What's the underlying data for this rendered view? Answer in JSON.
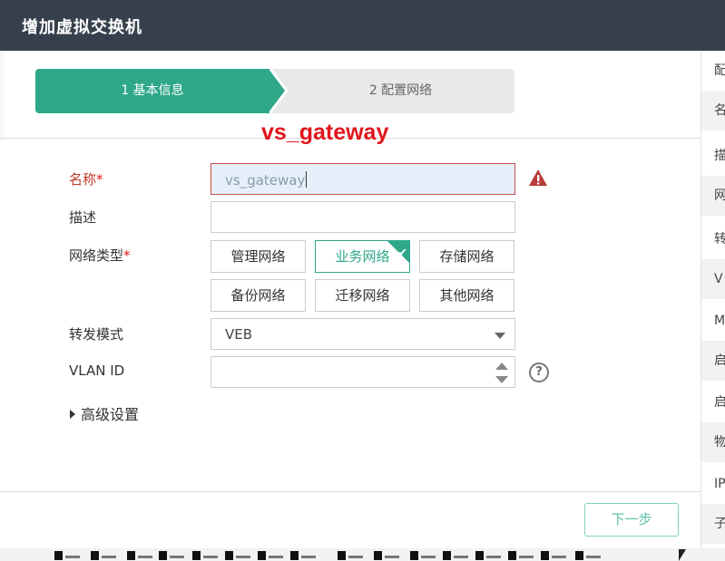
{
  "dialog": {
    "title": "增加虚拟交换机"
  },
  "steps": [
    {
      "label": "1 基本信息",
      "active": true
    },
    {
      "label": "2 配置网络",
      "active": false
    }
  ],
  "overlay_text": "vs_gateway",
  "form": {
    "name": {
      "label": "名称",
      "required_mark": "*",
      "value": "vs_gateway",
      "state": "error"
    },
    "description": {
      "label": "描述",
      "value": ""
    },
    "network_type": {
      "label": "网络类型",
      "required_mark": "*",
      "options": [
        "管理网络",
        "业务网络",
        "存储网络",
        "备份网络",
        "迁移网络",
        "其他网络"
      ],
      "selected": "业务网络"
    },
    "forward_mode": {
      "label": "转发模式",
      "value": "VEB"
    },
    "vlan_id": {
      "label": "VLAN ID",
      "value": ""
    },
    "advanced": {
      "label": "高级设置"
    }
  },
  "footer": {
    "next_label": "下一步"
  },
  "right_panel": {
    "rows": [
      "配",
      "名",
      "描",
      "网",
      "转",
      "V",
      "M",
      "启",
      "启",
      "物",
      "IP",
      "子"
    ]
  },
  "colors": {
    "titlebar": "#36404d",
    "accent": "#2fa88a",
    "error": "#e0151c"
  },
  "icons": [
    "warning-icon",
    "help-icon",
    "check-icon",
    "dropdown-caret-icon",
    "spinner-arrows-icon"
  ]
}
